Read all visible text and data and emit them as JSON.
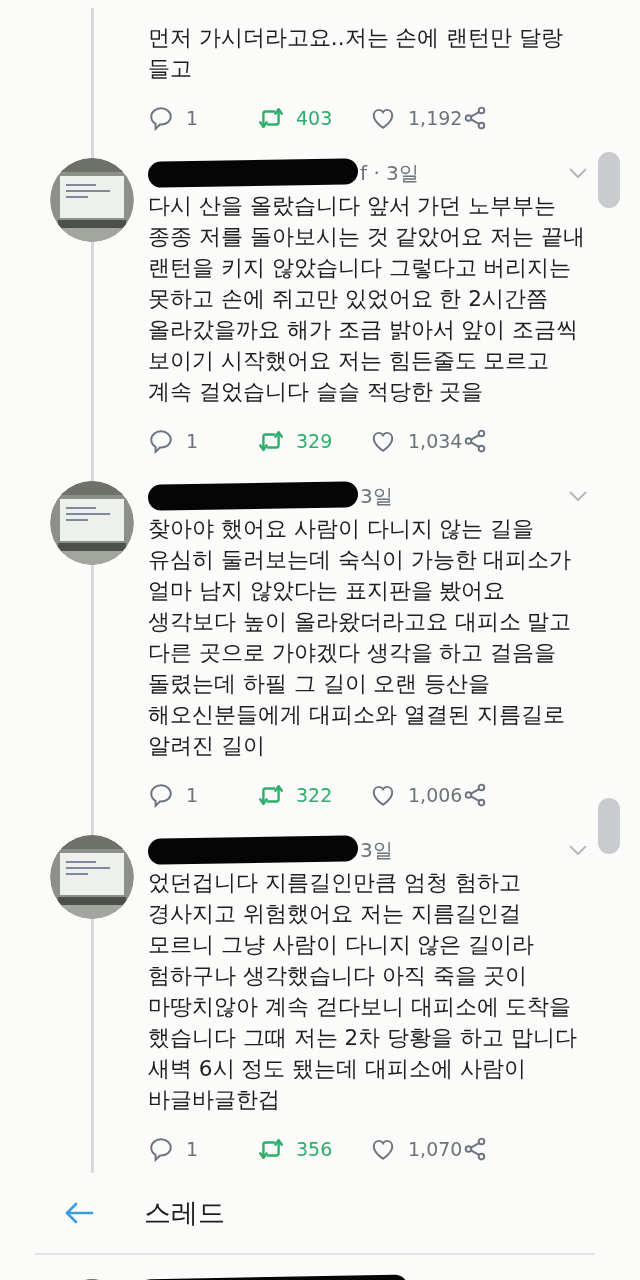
{
  "tweets": [
    {
      "text": "먼저 가시더라고요..저는 손에 랜턴만 달랑\n들고",
      "actions": {
        "replies": "1",
        "retweets": "403",
        "retweeted": true,
        "likes": "1,192",
        "liked": false
      }
    },
    {
      "meta": "f · 3일",
      "text": "다시 산을 올랐습니다 앞서 가던 노부부는\n종종 저를 돌아보시는 것 같았어요 저는 끝내\n랜턴을 키지 않았습니다 그렇다고 버리지는\n못하고 손에 쥐고만 있었어요 한 2시간쯤\n올라갔을까요 해가 조금 밝아서 앞이 조금씩\n보이기 시작했어요 저는 힘든줄도 모르고\n계속 걸었습니다 슬슬 적당한 곳을",
      "actions": {
        "replies": "1",
        "retweets": "329",
        "retweeted": true,
        "likes": "1,034",
        "liked": false
      }
    },
    {
      "meta": "3일",
      "text": "찾아야 했어요 사람이 다니지 않는 길을\n유심히 둘러보는데 숙식이 가능한 대피소가\n얼마 남지 않았다는 표지판을 봤어요\n생각보다 높이 올라왔더라고요 대피소 말고\n다른 곳으로 가야겠다 생각을 하고 걸음을\n돌렸는데 하필 그 길이 오랜 등산을\n해오신분들에게 대피소와 열결된 지름길로\n알려진 길이",
      "actions": {
        "replies": "1",
        "retweets": "322",
        "retweeted": true,
        "likes": "1,006",
        "liked": false
      }
    },
    {
      "meta": "3일",
      "text": "었던겁니다 지름길인만큼 엄청 험하고\n경사지고 위험했어요 저는 지름길인걸\n모르니 그냥 사람이 다니지 않은 길이라\n험하구나 생각했습니다 아직 죽을 곳이\n마땅치않아 계속 걷다보니 대피소에 도착을\n했습니다 그때 저는 2차 당황을 하고 맙니다\n새벽 6시 정도 됐는데 대피소에 사람이\n바글바글한겁",
      "actions": {
        "replies": "1",
        "retweets": "356",
        "retweeted": true,
        "likes": "1,070",
        "liked": false
      }
    }
  ],
  "thread_header": {
    "title": "스레드"
  }
}
